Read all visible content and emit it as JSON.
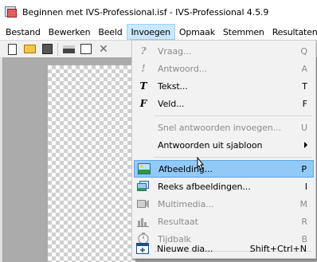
{
  "window": {
    "title": "Beginnen met IVS-Professional.isf - IVS-Professional 4.5.9"
  },
  "menubar": {
    "items": [
      "Bestand",
      "Bewerken",
      "Beeld",
      "Invoegen",
      "Opmaak",
      "Stemmen",
      "Resultaten"
    ],
    "active": "Invoegen"
  },
  "toolbar": {
    "icons": [
      "new-icon",
      "open-icon",
      "save-icon",
      "print-icon",
      "properties-icon",
      "close-icon"
    ]
  },
  "insert_menu": {
    "items": [
      {
        "label": "Vraag...",
        "shortcut": "Q",
        "enabled": false,
        "icon": "question-icon"
      },
      {
        "label": "Antwoord...",
        "shortcut": "A",
        "enabled": false,
        "icon": "answer-icon"
      },
      {
        "label": "Tekst...",
        "shortcut": "T",
        "enabled": true,
        "icon": "text-icon"
      },
      {
        "label": "Veld...",
        "shortcut": "F",
        "enabled": true,
        "icon": "field-icon"
      },
      {
        "label": "Snel antwoorden invoegen...",
        "shortcut": "U",
        "enabled": false
      },
      {
        "label": "Antwoorden uit sjabloon",
        "shortcut": "",
        "enabled": true,
        "submenu": true
      },
      {
        "label": "Afbeelding...",
        "shortcut": "P",
        "enabled": true,
        "highlighted": true,
        "icon": "image-icon"
      },
      {
        "label": "Reeks afbeeldingen...",
        "shortcut": "I",
        "enabled": true,
        "icon": "image-series-icon"
      },
      {
        "label": "Multimedia...",
        "shortcut": "M",
        "enabled": false,
        "icon": "multimedia-icon"
      },
      {
        "label": "Resultaat",
        "shortcut": "R",
        "enabled": false,
        "icon": "result-icon"
      },
      {
        "label": "Tijdbalk",
        "shortcut": "B",
        "enabled": false,
        "icon": "timer-icon"
      },
      {
        "label": "Nieuwe dia...",
        "shortcut": "Shift+Ctrl+N",
        "enabled": true,
        "icon": "new-slide-icon"
      }
    ]
  },
  "colors": {
    "highlight": "#91c9f7",
    "menu_active": "#cce8ff",
    "disabled_text": "#8c8c8c"
  }
}
